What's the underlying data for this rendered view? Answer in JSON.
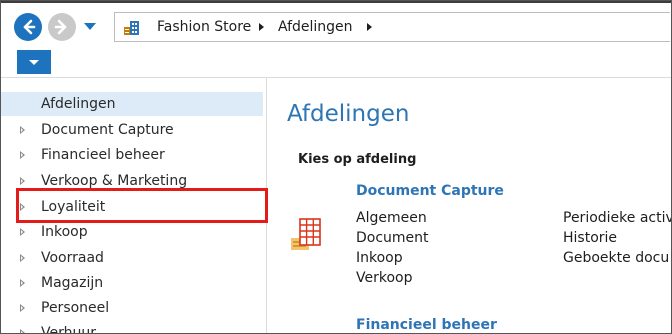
{
  "breadcrumb": [
    "Fashion Store",
    "Afdelingen"
  ],
  "navigation": {
    "items": [
      {
        "label": "Afdelingen"
      },
      {
        "label": "Document Capture"
      },
      {
        "label": "Financieel beheer"
      },
      {
        "label": "Verkoop & Marketing"
      },
      {
        "label": "Loyaliteit"
      },
      {
        "label": "Inkoop"
      },
      {
        "label": "Voorraad"
      },
      {
        "label": "Magazijn"
      },
      {
        "label": "Personeel"
      },
      {
        "label": "Verhuur"
      }
    ]
  },
  "content": {
    "title": "Afdelingen",
    "subtitle": "Kies op afdeling",
    "groups": [
      {
        "title": "Document Capture",
        "col1": [
          "Algemeen",
          "Document",
          "Inkoop",
          "Verkoop"
        ],
        "col2": [
          "Periodieke activ",
          "Historie",
          "Geboekte docu"
        ]
      },
      {
        "title": "Financieel beheer"
      }
    ]
  },
  "colors": {
    "accent": "#1e73be",
    "link": "#2e75b6",
    "highlight": "#e51b1b",
    "selected": "#dcebf7"
  },
  "icons": {
    "back": "arrow-left-icon",
    "forward": "arrow-right-icon",
    "dropdown": "chevron-down-icon",
    "address": "company-icon",
    "group": "grid-document-icon"
  }
}
